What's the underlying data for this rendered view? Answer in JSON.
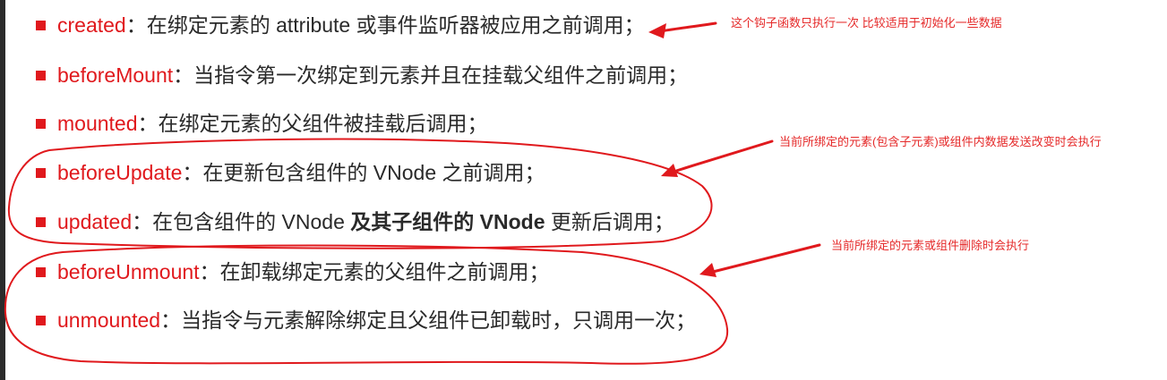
{
  "hooks": [
    {
      "name": "created",
      "desc": "在绑定元素的 attribute 或事件监听器被应用之前调用；"
    },
    {
      "name": "beforeMount",
      "desc": "当指令第一次绑定到元素并且在挂载父组件之前调用；"
    },
    {
      "name": "mounted",
      "desc": "在绑定元素的父组件被挂载后调用；"
    },
    {
      "name": "beforeUpdate",
      "desc": "在更新包含组件的 VNode 之前调用；"
    },
    {
      "name": "updated",
      "desc_pre": "在包含组件的 VNode ",
      "desc_bold": "及其子组件的 VNode",
      "desc_post": " 更新后调用；"
    },
    {
      "name": "beforeUnmount",
      "desc": "在卸载绑定元素的父组件之前调用；"
    },
    {
      "name": "unmounted",
      "desc": "当指令与元素解除绑定且父组件已卸载时，只调用一次；"
    }
  ],
  "colon": "：",
  "annotations": {
    "created_note": "这个钩子函数只执行一次  比较适用于初始化一些数据",
    "update_note": "当前所绑定的元素(包含子元素)或组件内数据发送改变时会执行",
    "unmount_note": "当前所绑定的元素或组件删除时会执行"
  },
  "colors": {
    "hook": "#e0191d",
    "annotation": "#e52a2a",
    "text": "#2a2a2a"
  }
}
